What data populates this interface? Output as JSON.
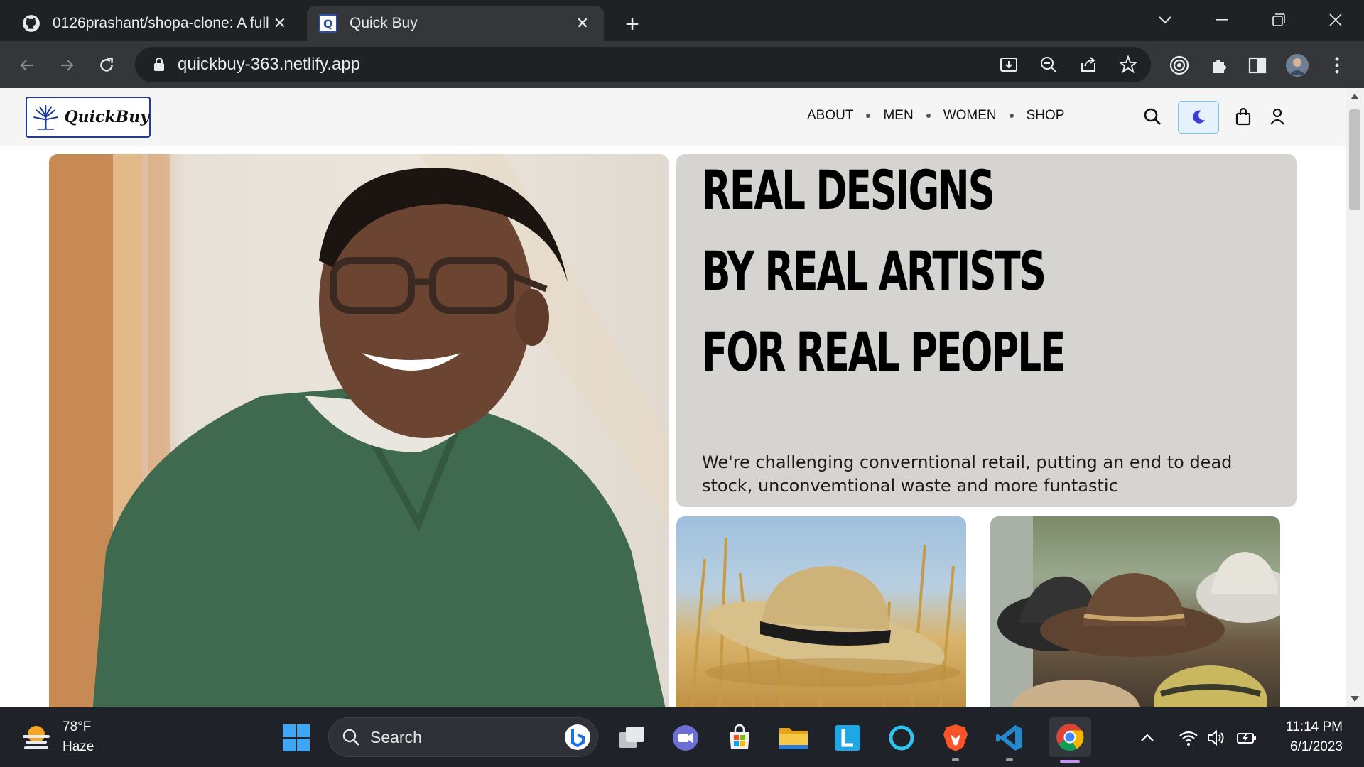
{
  "browser": {
    "tabs": [
      {
        "title": "0126prashant/shopa-clone: A full",
        "active": false,
        "icon": "github-icon"
      },
      {
        "title": "Quick Buy",
        "active": true,
        "icon": "quickbuy-favicon"
      }
    ],
    "url": "quickbuy-363.netlify.app"
  },
  "site": {
    "logo_text": "QuickBuy",
    "nav": [
      {
        "label": "ABOUT"
      },
      {
        "label": "MEN"
      },
      {
        "label": "WOMEN"
      },
      {
        "label": "SHOP"
      }
    ],
    "hero": {
      "headline": [
        "REAL DESIGNS",
        "BY REAL ARTISTS",
        "FOR REAL PEOPLE"
      ],
      "tagline": "We're challenging converntional retail, putting an end to dead stock, unconvemtional waste and more funtastic"
    }
  },
  "taskbar": {
    "weather_temp": "78°F",
    "weather_desc": "Haze",
    "search_label": "Search",
    "time": "11:14 PM",
    "date": "6/1/2023"
  },
  "colors": {
    "accent_toggle_bg": "#e5f2fb",
    "accent_toggle_border": "#7cc3ec",
    "moon": "#3b3bd6",
    "hero_panel": "#d6d4d0"
  }
}
